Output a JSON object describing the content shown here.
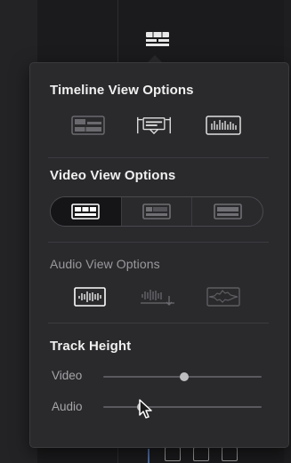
{
  "timeline_view": {
    "title": "Timeline View Options",
    "buttons": [
      "filmstrip-view-icon",
      "audio-waveform-view-icon",
      "waveform-icon"
    ]
  },
  "video_view": {
    "title": "Video View Options",
    "options": [
      "thumbnail-full-icon",
      "thumbnail-partial-icon",
      "thumbnail-none-icon"
    ],
    "active_index": 0
  },
  "audio_view": {
    "title": "Audio View Options",
    "options": [
      "waveform-full-icon",
      "waveform-down-icon",
      "waveform-outline-icon"
    ],
    "active_index": 0
  },
  "track_height": {
    "title": "Track Height",
    "video_label": "Video",
    "audio_label": "Audio",
    "video_value": 0.51,
    "audio_value": 0.24
  },
  "colors": {
    "panel": "#2a2a2d",
    "text": "#f0f0f0",
    "dim_text": "#9a9a9e",
    "accent_border": "#ffffff"
  }
}
